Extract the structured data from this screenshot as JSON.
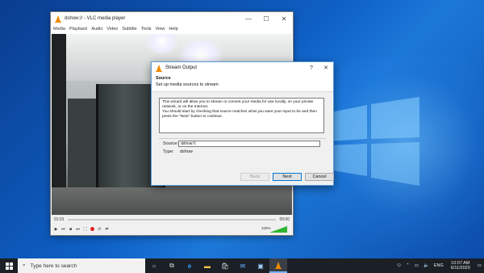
{
  "vlc": {
    "title": "dshow:// - VLC media player",
    "menu": [
      "Media",
      "Playback",
      "Audio",
      "Video",
      "Subtitle",
      "Tools",
      "View",
      "Help"
    ],
    "time_elapsed": "01:01",
    "time_total": "00:00",
    "volume_pct": "100%"
  },
  "dialog": {
    "title": "Stream Output",
    "help_btn": "?",
    "close_btn": "✕",
    "header_title": "Source",
    "header_subtitle": "Set up media sources to stream",
    "help_line1": "This wizard will allow you to stream or convert your media for use locally, on your private network, or on the Internet.",
    "help_line2": "You should start by checking that source matches what you want your input to be and then press the \"Next\" button to continue.",
    "source_label": "Source:",
    "source_value": "dshow:\\\\",
    "type_label": "Type:",
    "type_value": "dshow",
    "back_label": "Back",
    "next_label": "Next",
    "cancel_label": "Cancel"
  },
  "taskbar": {
    "search_placeholder": "Type here to search",
    "lang": "ENG",
    "time": "10:07 AM",
    "date": "6/11/2020"
  },
  "colors": {
    "accent": "#0078d7",
    "record": "#e02020",
    "volume": "#2fb52f"
  }
}
